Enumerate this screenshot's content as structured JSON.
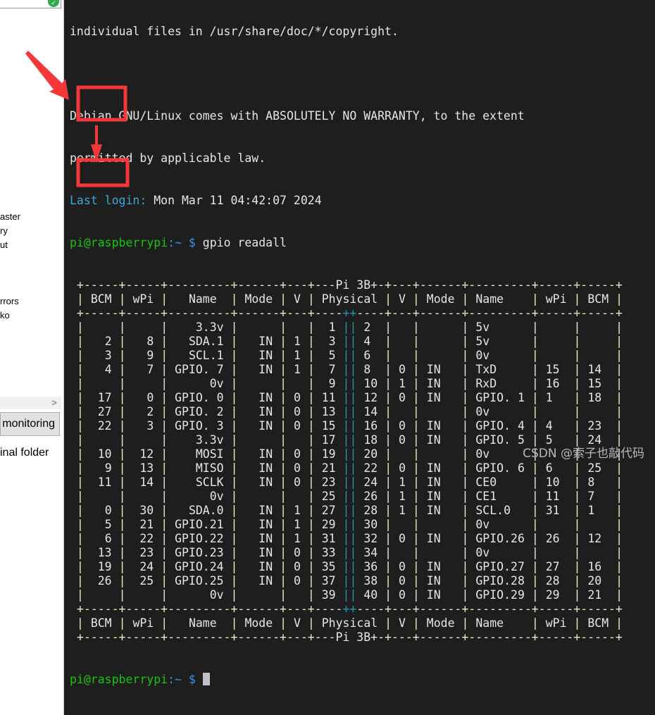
{
  "left_panel": {
    "items": [
      "aster",
      "ry",
      "ut",
      "rrors",
      "ko"
    ],
    "scroll_arrow": ">",
    "monitoring_button": "monitoring",
    "folder_link": "inal folder",
    "check_icon": "✓"
  },
  "terminal": {
    "motd": [
      "individual files in /usr/share/doc/*/copyright.",
      "",
      "Debian GNU/Linux comes with ABSOLUTELY NO WARRANTY, to the extent",
      "permitted by applicable law."
    ],
    "last_login_label": "Last login:",
    "last_login_value": " Mon Mar 11 04:42:07 2024",
    "prompt_user": "pi@raspberrypi",
    "prompt_path": ":~ $",
    "command": " gpio readall",
    "board_model": "Pi 3B+",
    "headers": [
      "BCM",
      "wPi",
      "Name",
      "Mode",
      "V",
      "Physical",
      "V",
      "Mode",
      "Name",
      "wPi",
      "BCM"
    ],
    "rows": [
      [
        "",
        "",
        "3.3v",
        "",
        "",
        "1",
        "2",
        "",
        "",
        "5v",
        "",
        ""
      ],
      [
        "2",
        "8",
        "SDA.1",
        "IN",
        "1",
        "3",
        "4",
        "",
        "",
        "5v",
        "",
        ""
      ],
      [
        "3",
        "9",
        "SCL.1",
        "IN",
        "1",
        "5",
        "6",
        "",
        "",
        "0v",
        "",
        ""
      ],
      [
        "4",
        "7",
        "GPIO. 7",
        "IN",
        "1",
        "7",
        "8",
        "0",
        "IN",
        "TxD",
        "15",
        "14"
      ],
      [
        "",
        "",
        "0v",
        "",
        "",
        "9",
        "10",
        "1",
        "IN",
        "RxD",
        "16",
        "15"
      ],
      [
        "17",
        "0",
        "GPIO. 0",
        "IN",
        "0",
        "11",
        "12",
        "0",
        "IN",
        "GPIO. 1",
        "1",
        "18"
      ],
      [
        "27",
        "2",
        "GPIO. 2",
        "IN",
        "0",
        "13",
        "14",
        "",
        "",
        "0v",
        "",
        ""
      ],
      [
        "22",
        "3",
        "GPIO. 3",
        "IN",
        "0",
        "15",
        "16",
        "0",
        "IN",
        "GPIO. 4",
        "4",
        "23"
      ],
      [
        "",
        "",
        "3.3v",
        "",
        "",
        "17",
        "18",
        "0",
        "IN",
        "GPIO. 5",
        "5",
        "24"
      ],
      [
        "10",
        "12",
        "MOSI",
        "IN",
        "0",
        "19",
        "20",
        "",
        "",
        "0v",
        "",
        ""
      ],
      [
        "9",
        "13",
        "MISO",
        "IN",
        "0",
        "21",
        "22",
        "0",
        "IN",
        "GPIO. 6",
        "6",
        "25"
      ],
      [
        "11",
        "14",
        "SCLK",
        "IN",
        "0",
        "23",
        "24",
        "1",
        "IN",
        "CE0",
        "10",
        "8"
      ],
      [
        "",
        "",
        "0v",
        "",
        "",
        "25",
        "26",
        "1",
        "IN",
        "CE1",
        "11",
        "7"
      ],
      [
        "0",
        "30",
        "SDA.0",
        "IN",
        "1",
        "27",
        "28",
        "1",
        "IN",
        "SCL.0",
        "31",
        "1"
      ],
      [
        "5",
        "21",
        "GPIO.21",
        "IN",
        "1",
        "29",
        "30",
        "",
        "",
        "0v",
        "",
        ""
      ],
      [
        "6",
        "22",
        "GPIO.22",
        "IN",
        "1",
        "31",
        "32",
        "0",
        "IN",
        "GPIO.26",
        "26",
        "12"
      ],
      [
        "13",
        "23",
        "GPIO.23",
        "IN",
        "0",
        "33",
        "34",
        "",
        "",
        "0v",
        "",
        ""
      ],
      [
        "19",
        "24",
        "GPIO.24",
        "IN",
        "0",
        "35",
        "36",
        "0",
        "IN",
        "GPIO.27",
        "27",
        "16"
      ],
      [
        "26",
        "25",
        "GPIO.25",
        "IN",
        "0",
        "37",
        "38",
        "0",
        "IN",
        "GPIO.28",
        "28",
        "20"
      ],
      [
        "",
        "",
        "0v",
        "",
        "",
        "39",
        "40",
        "0",
        "IN",
        "GPIO.29",
        "29",
        "21"
      ]
    ]
  },
  "watermark": "CSDN @索子也敲代码",
  "colors": {
    "annotation": "#f5373a",
    "prompt_green": "#16c60c",
    "prompt_blue": "#3b8eea",
    "background": "#1e1e1e"
  }
}
